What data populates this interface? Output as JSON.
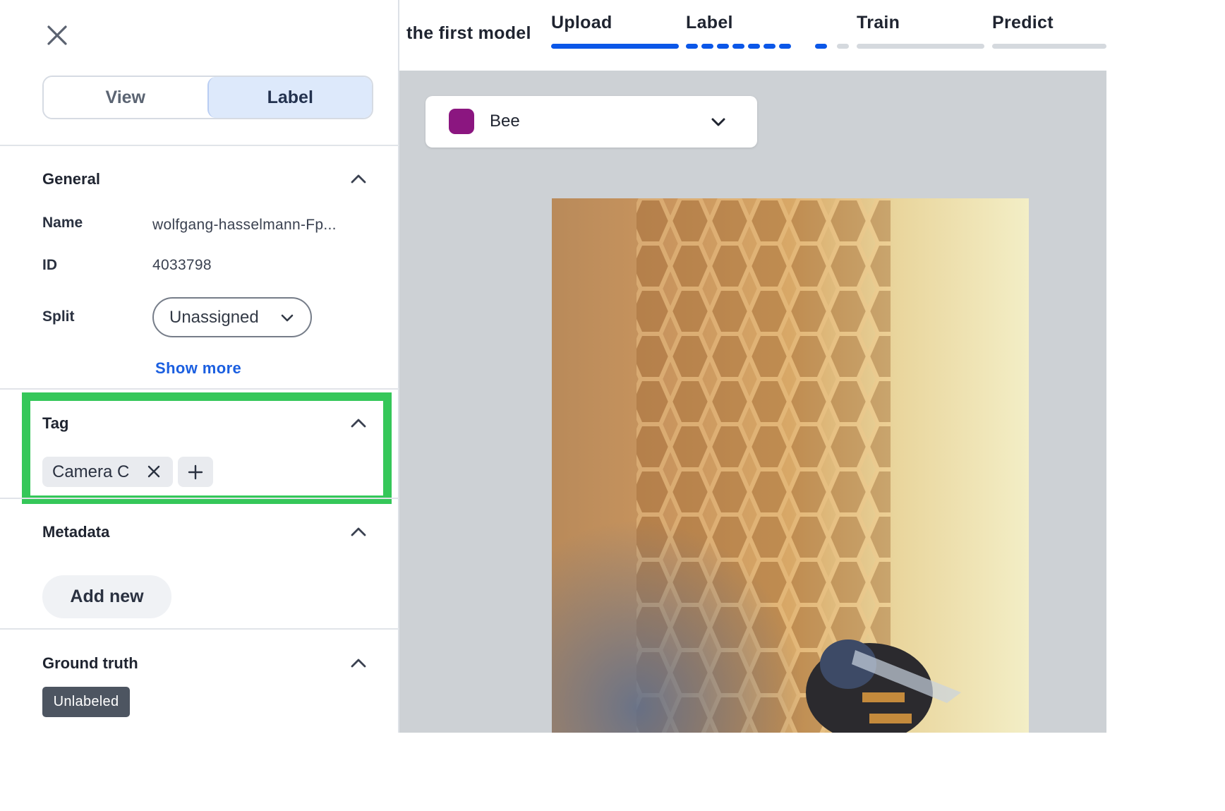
{
  "panel": {
    "mode_tabs": [
      {
        "label": "View",
        "active": false
      },
      {
        "label": "Label",
        "active": true
      }
    ]
  },
  "general": {
    "title": "General",
    "name_label": "Name",
    "name_value": "wolfgang-hasselmann-Fp...",
    "id_label": "ID",
    "id_value": "4033798",
    "split_label": "Split",
    "split_value": "Unassigned",
    "show_more": "Show more"
  },
  "tag": {
    "title": "Tag",
    "chips": [
      "Camera C"
    ]
  },
  "metadata": {
    "title": "Metadata",
    "add_new": "Add new"
  },
  "ground_truth": {
    "title": "Ground truth",
    "badge": "Unlabeled"
  },
  "header": {
    "model_name": "the first model",
    "steps": [
      {
        "label": "Upload",
        "state": "complete"
      },
      {
        "label": "Label",
        "state": "in-progress"
      },
      {
        "label": "Train",
        "state": "pending"
      },
      {
        "label": "Predict",
        "state": "pending"
      }
    ]
  },
  "annotation": {
    "class_name": "Bee",
    "class_color": "#8b1680"
  },
  "colors": {
    "accent": "#0b57e8",
    "highlight": "#35c759",
    "canvas_bg": "#cdd1d5"
  }
}
